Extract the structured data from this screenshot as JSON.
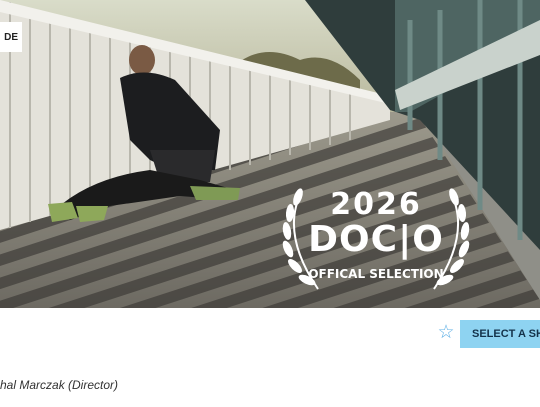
{
  "hero": {
    "tag_label": "DE",
    "laurel": {
      "year": "2026",
      "festival": "DOC|O",
      "selection": "OFFICAL SELECTION"
    }
  },
  "actions": {
    "select_label": "SELECT A SHO",
    "favorite_icon": "star-outline-icon"
  },
  "credit": "hal Marczak (Director)",
  "colors": {
    "button_bg": "#8ed3f1",
    "star": "#5fb0e6"
  }
}
